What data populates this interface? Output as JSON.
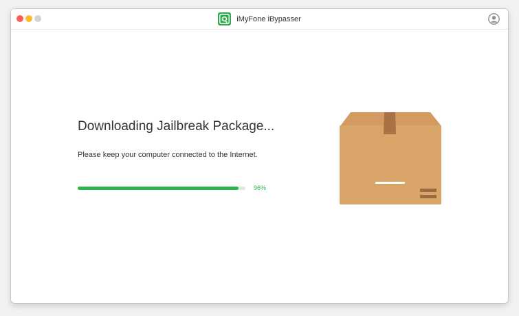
{
  "window": {
    "title": "iMyFone iBypasser",
    "controls": [
      "close-button",
      "minimize-button",
      "maximize-button"
    ],
    "account_icon": "user-account-icon"
  },
  "main": {
    "heading": "Downloading Jailbreak Package...",
    "subtext": "Please keep your computer connected to the Internet.",
    "progress": {
      "percent": 96,
      "label": "96%"
    },
    "illustration": "cardboard-box-icon"
  },
  "colors": {
    "accent_green": "#2eb24d",
    "progress_track": "#d6ecd9",
    "close": "#fc5f57",
    "minimize": "#fdbc2e",
    "maximize": "#d3d3d3",
    "box_top": "#d39a61",
    "box_front": "#d8a468"
  }
}
